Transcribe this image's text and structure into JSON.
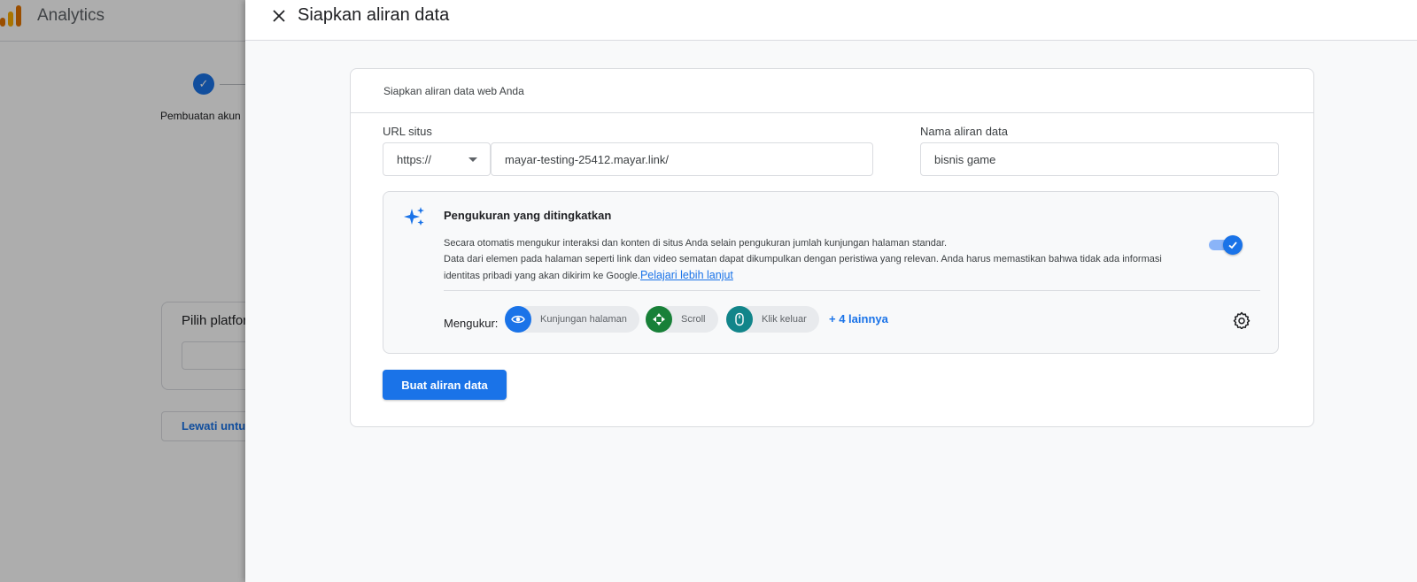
{
  "background": {
    "app_title": "Analytics",
    "step_label": "Pembuatan akun",
    "card_title": "Pilih platform",
    "skip_label": "Lewati untuk"
  },
  "drawer": {
    "title": "Siapkan aliran data",
    "panel_heading": "Siapkan aliran data web Anda",
    "url_label": "URL situs",
    "protocol_value": "https://",
    "url_value": "mayar-testing-25412.mayar.link/",
    "stream_name_label": "Nama aliran data",
    "stream_name_value": "bisnis game",
    "enhanced": {
      "title": "Pengukuran yang ditingkatkan",
      "desc_line1": "Secara otomatis mengukur interaksi dan konten di situs Anda selain pengukuran jumlah kunjungan halaman standar.",
      "desc_line2": "Data dari elemen pada halaman seperti link dan video sematan dapat dikumpulkan dengan peristiwa yang relevan. Anda harus memastikan bahwa tidak ada informasi identitas pribadi yang akan dikirim ke Google.",
      "learn_more": "Pelajari lebih lanjut",
      "toggle_on": true,
      "measure_label": "Mengukur:",
      "chips": [
        "Kunjungan halaman",
        "Scroll",
        "Klik keluar"
      ],
      "more_label": "+ 4 lainnya"
    },
    "create_button": "Buat aliran data"
  },
  "colors": {
    "accent": "#1a73e8",
    "chip_scroll": "#188038",
    "chip_outbound": "#12858a"
  }
}
